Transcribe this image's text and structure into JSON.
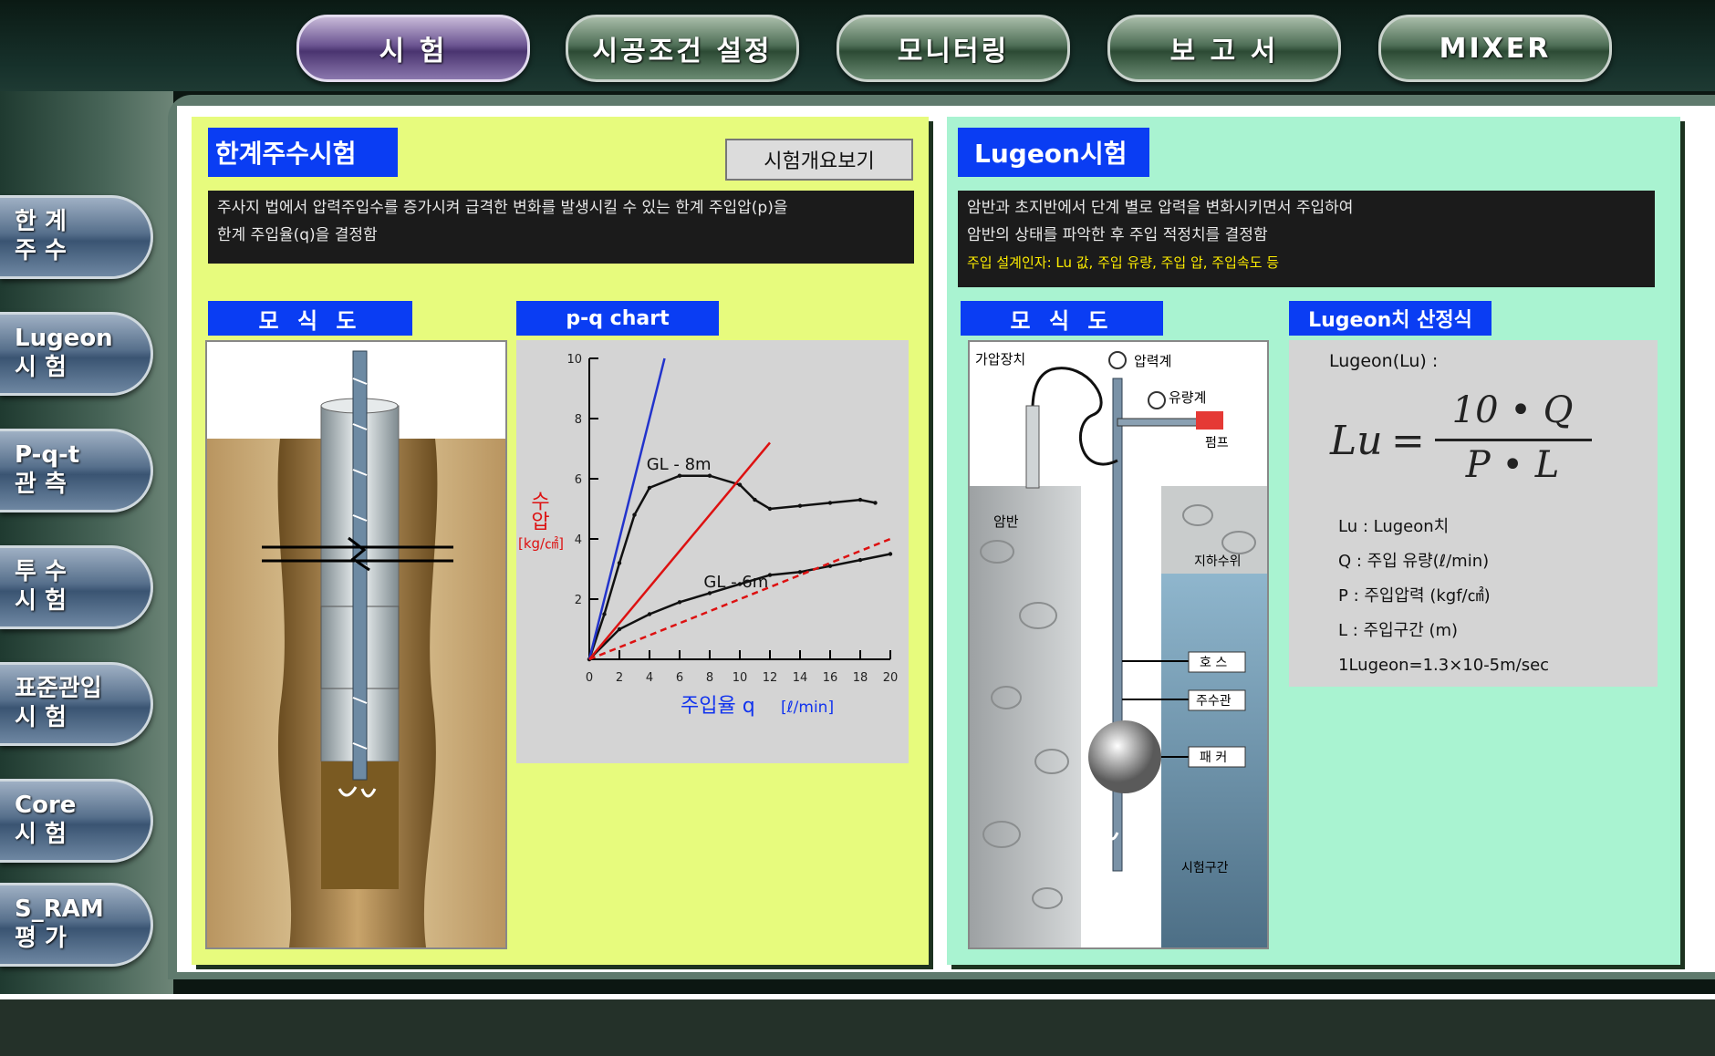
{
  "top_nav": [
    {
      "label": "시  험",
      "active": true
    },
    {
      "label": "시공조건 설정",
      "active": false
    },
    {
      "label": "모니터링",
      "active": false
    },
    {
      "label": "보 고 서",
      "active": false
    },
    {
      "label": "MIXER",
      "active": false
    }
  ],
  "side_nav": [
    {
      "label": "한 계\n주 수"
    },
    {
      "label": "Lugeon\n시 험"
    },
    {
      "label": "P-q-t\n관 측"
    },
    {
      "label": "투 수\n시 험"
    },
    {
      "label": "표준관입\n시 험"
    },
    {
      "label": "Core\n시 험"
    },
    {
      "label": "S_RAM\n평 가"
    }
  ],
  "left_panel": {
    "title": "한계주수시험",
    "overview_button": "시험개요보기",
    "desc_line1": "주사지 법에서 압력주입수를 증가시켜 급격한 변화를 발생시킬 수 있는 한계 주입압(p)을",
    "desc_line2": "한계 주입율(q)을 결정함",
    "schematic_label": "모 식 도",
    "chart_label": "p-q chart",
    "chart_curve1": "GL - 8m",
    "chart_curve2": "GL - 6m"
  },
  "right_panel": {
    "title": "Lugeon시험",
    "desc_line1": "암반과 초지반에서 단계 별로 압력을 변화시키면서 주입하여",
    "desc_line2": "암반의 상태를 파악한 후 주입 적정치를 결정함",
    "desc_line3": "주입 설계인자: Lu 값, 주입 유량, 주입 압, 주입속도 등",
    "schematic_label": "모 식 도",
    "formula_label": "Lugeon치 산정식",
    "diagram_labels": {
      "rig": "가압장치",
      "gauge": "압력계",
      "flowmeter": "유량계",
      "pump": "펌프",
      "rock": "암반",
      "water_level": "지하수위",
      "hose": "호 스",
      "pipe": "주수관",
      "packer": "패 커",
      "section": "시험구간"
    },
    "formula_title": "Lugeon(Lu) :",
    "formula_lhs": "Lu",
    "formula_eq": "=",
    "formula_num": "10 • Q",
    "formula_den": "P • L",
    "defs": [
      "Lu : Lugeon치",
      "Q : 주입 유량(ℓ/min)",
      "P : 주입압력 (kgf/㎠)",
      "L : 주입구간 (m)",
      "1Lugeon=1.3×10-5m/sec"
    ]
  },
  "chart_data": {
    "type": "line",
    "xlabel": "주입율 q",
    "xunit": "[ℓ/min]",
    "ylabel": "수압",
    "yunit": "[kg/㎠]",
    "xlim": [
      0,
      20
    ],
    "ylim": [
      0,
      10
    ],
    "xticks": [
      0,
      2,
      4,
      6,
      8,
      10,
      12,
      14,
      16,
      18,
      20
    ],
    "yticks": [
      2,
      4,
      6,
      8,
      10
    ],
    "series": [
      {
        "name": "GL - 8m",
        "color": "#111111",
        "style": "solid",
        "points": [
          [
            0,
            0
          ],
          [
            1,
            1.5
          ],
          [
            2,
            3.2
          ],
          [
            3,
            4.8
          ],
          [
            4,
            5.7
          ],
          [
            6,
            6.1
          ],
          [
            8,
            6.1
          ],
          [
            10,
            5.8
          ],
          [
            11,
            5.3
          ],
          [
            12,
            5.0
          ],
          [
            14,
            5.1
          ],
          [
            16,
            5.2
          ],
          [
            18,
            5.3
          ],
          [
            19,
            5.2
          ]
        ]
      },
      {
        "name": "GL - 6m",
        "color": "#111111",
        "style": "solid",
        "points": [
          [
            0,
            0
          ],
          [
            2,
            1.0
          ],
          [
            4,
            1.5
          ],
          [
            6,
            1.9
          ],
          [
            8,
            2.2
          ],
          [
            10,
            2.5
          ],
          [
            12,
            2.8
          ],
          [
            14,
            2.9
          ],
          [
            16,
            3.1
          ],
          [
            18,
            3.3
          ],
          [
            20,
            3.5
          ]
        ]
      },
      {
        "name": "",
        "color": "#2233cc",
        "style": "solid",
        "points": [
          [
            0,
            0
          ],
          [
            5,
            10
          ]
        ]
      },
      {
        "name": "",
        "color": "#dd1111",
        "style": "solid",
        "points": [
          [
            0,
            0
          ],
          [
            12,
            7.2
          ]
        ]
      },
      {
        "name": "",
        "color": "#dd1111",
        "style": "dashed",
        "points": [
          [
            0,
            0
          ],
          [
            20,
            4.0
          ]
        ]
      }
    ]
  }
}
